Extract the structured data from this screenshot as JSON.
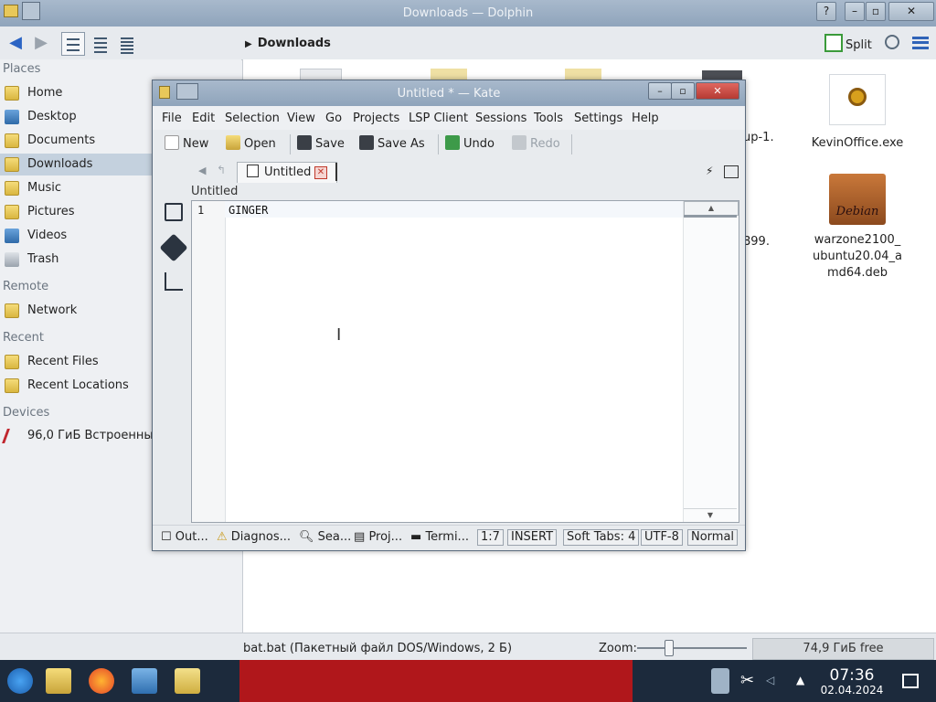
{
  "dolphin": {
    "title": "Downloads — Dolphin",
    "breadcrumb": "Downloads",
    "split_label": "Split",
    "places_heading": "Places",
    "places": [
      "Home",
      "Desktop",
      "Documents",
      "Downloads",
      "Music",
      "Pictures",
      "Videos",
      "Trash"
    ],
    "remote_heading": "Remote",
    "remote": [
      "Network"
    ],
    "recent_heading": "Recent",
    "recent": [
      "Recent Files",
      "Recent Locations"
    ],
    "devices_heading": "Devices",
    "devices": [
      "96,0 ГиБ Встроенный"
    ],
    "files": [
      {
        "name": "KevinOffice.exe"
      },
      {
        "name": "warzone2100_ubuntu20.04_amd64.deb",
        "thumb_label": "Debian"
      }
    ],
    "partial_labels": [
      "up-1.",
      "899."
    ],
    "status_text": "bat.bat (Пакетный файл DOS/Windows, 2 Б)",
    "zoom_label": "Zoom:",
    "free_space": "74,9 ГиБ free"
  },
  "kate": {
    "title": "Untitled * — Kate",
    "menu": [
      "File",
      "Edit",
      "Selection",
      "View",
      "Go",
      "Projects",
      "LSP Client",
      "Sessions",
      "Tools",
      "Settings",
      "Help"
    ],
    "toolbar": {
      "new": "New",
      "open": "Open",
      "save": "Save",
      "save_as": "Save As",
      "undo": "Undo",
      "redo": "Redo"
    },
    "tab_label": "Untitled",
    "doc_name": "Untitled",
    "line_number": "1",
    "line_text": "GINGER",
    "status": {
      "output": "Out...",
      "diagnostics": "Diagnos...",
      "search": "Sea...",
      "projects": "Proj...",
      "terminal": "Termi...",
      "cursor": "1:7",
      "mode": "INSERT",
      "tabs": "Soft Tabs: 4",
      "encoding": "UTF-8",
      "input_mode": "Normal"
    }
  },
  "taskbar": {
    "time": "07:36",
    "date": "02.04.2024"
  },
  "colors": {
    "titlebar": "#9aaec3",
    "selection": "#c4d1de",
    "taskbar": "#1c2a3c",
    "close_button": "#c4433b"
  }
}
